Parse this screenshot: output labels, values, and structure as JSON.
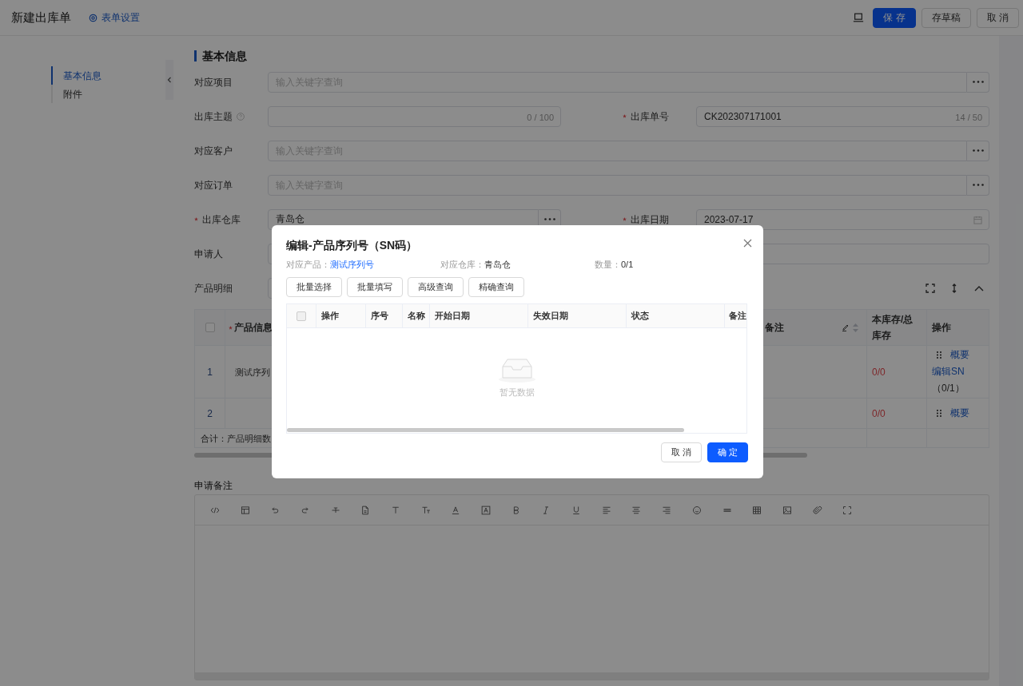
{
  "header": {
    "title": "新建出库单",
    "settings_link": "表单设置",
    "buttons": [
      {
        "label": "保 存",
        "kind": "primary"
      },
      {
        "label": "存草稿",
        "kind": "default"
      },
      {
        "label": "取 消",
        "kind": "default"
      }
    ]
  },
  "nav": {
    "items": [
      {
        "label": "基本信息",
        "selected": true
      },
      {
        "label": "附件",
        "selected": false
      }
    ]
  },
  "section_title": "基本信息",
  "form": {
    "rows": [
      {
        "fields": [
          {
            "label": "对应项目",
            "kind": "lookup",
            "required": false,
            "placeholder": "输入关键字查询"
          }
        ]
      },
      {
        "fields": [
          {
            "label": "出库主题",
            "kind": "text",
            "required": false,
            "help": true,
            "counter": "0 / 100"
          },
          {
            "label": "出库单号",
            "kind": "text",
            "required": true,
            "value": "CK202307171001",
            "counter": "14 / 50"
          }
        ]
      },
      {
        "fields": [
          {
            "label": "对应客户",
            "kind": "lookup",
            "required": false,
            "placeholder": "输入关键字查询"
          }
        ]
      },
      {
        "fields": [
          {
            "label": "对应订单",
            "kind": "lookup",
            "required": false,
            "placeholder": "输入关键字查询"
          }
        ]
      },
      {
        "fields": [
          {
            "label": "出库仓库",
            "kind": "lookup",
            "required": true,
            "value": "青岛仓"
          },
          {
            "label": "出库日期",
            "kind": "date",
            "required": true,
            "value": "2023-07-17"
          }
        ]
      },
      {
        "fields": [
          {
            "label": "申请人",
            "kind": "text",
            "required": false
          }
        ]
      }
    ]
  },
  "products": {
    "label": "产品明细",
    "select_all": {
      "checked": false
    },
    "columns": [
      {
        "label": "产品信息",
        "required": true,
        "editable": false
      },
      {
        "label": "备注",
        "required": false,
        "editable": true
      },
      {
        "label": "本库存/总库存",
        "required": false,
        "editable": false
      },
      {
        "label": "操作",
        "required": false,
        "editable": false
      }
    ],
    "rows": [
      {
        "index": "1",
        "product": "测试序列",
        "stock": "0/0",
        "action": "概要",
        "sn_link": "编辑SN",
        "sn_count": "（0/1）"
      },
      {
        "index": "2",
        "stock": "0/0",
        "action": "概要"
      }
    ],
    "summary": "合计：产品明细数"
  },
  "remarks": {
    "label": "申请备注"
  },
  "modal": {
    "title": "编辑-产品序列号（SN码）",
    "info": [
      {
        "label": "对应产品：",
        "value": "测试序列号",
        "kind": "link"
      },
      {
        "label": "对应仓库：",
        "value": "青岛仓",
        "kind": "text"
      },
      {
        "label": "数量：",
        "value": "0/1",
        "kind": "text"
      }
    ],
    "buttons": [
      "批量选择",
      "批量填写",
      "高级查询",
      "精确查询"
    ],
    "select_all": {
      "checked": false
    },
    "columns": [
      "操作",
      "序号",
      "名称",
      "开始日期",
      "失效日期",
      "状态",
      "备注"
    ],
    "empty_text": "暂无数据",
    "footer_buttons": [
      {
        "label": "取 消",
        "kind": "default"
      },
      {
        "label": "确 定",
        "kind": "primary"
      }
    ]
  }
}
